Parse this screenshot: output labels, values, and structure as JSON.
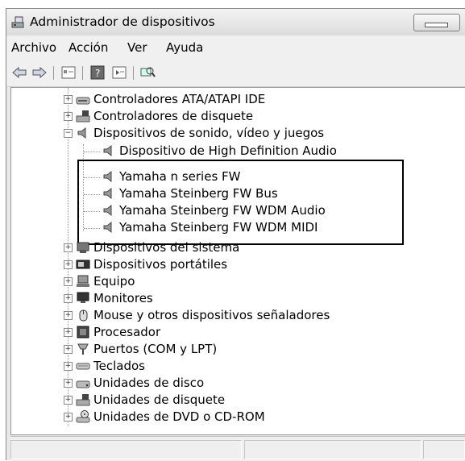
{
  "window": {
    "title": "Administrador de dispositivos"
  },
  "menu": {
    "items": [
      {
        "label": "Archivo"
      },
      {
        "label": "Acción"
      },
      {
        "label": "Ver"
      },
      {
        "label": "Ayuda"
      }
    ]
  },
  "toolbar": {
    "buttons": [
      "back-arrow-icon",
      "forward-arrow-icon",
      "properties-icon",
      "help-icon",
      "details-icon",
      "scan-hardware-icon"
    ]
  },
  "tree": {
    "items": [
      {
        "label": "Controladores ATA/ATAPI IDE",
        "icon": "ide-controller-icon",
        "level": 1,
        "expander": "+"
      },
      {
        "label": "Controladores de disquete",
        "icon": "floppy-controller-icon",
        "level": 1,
        "expander": "+"
      },
      {
        "label": "Dispositivos de sonido, vídeo y juegos",
        "icon": "speaker-icon",
        "level": 1,
        "expander": "-"
      },
      {
        "label": "Dispositivo de High Definition Audio",
        "icon": "speaker-icon",
        "level": 2
      },
      {
        "label": "Yamaha n series FW",
        "icon": "speaker-icon",
        "level": 2
      },
      {
        "label": "Yamaha Steinberg FW Bus",
        "icon": "speaker-icon",
        "level": 2
      },
      {
        "label": "Yamaha Steinberg FW WDM Audio",
        "icon": "speaker-icon",
        "level": 2
      },
      {
        "label": "Yamaha Steinberg FW WDM MIDI",
        "icon": "speaker-icon",
        "level": 2
      },
      {
        "label": "Dispositivos del sistema",
        "icon": "system-device-icon",
        "level": 1,
        "expander": "+"
      },
      {
        "label": "Dispositivos portátiles",
        "icon": "portable-device-icon",
        "level": 1,
        "expander": "+"
      },
      {
        "label": "Equipo",
        "icon": "computer-icon",
        "level": 1,
        "expander": "+"
      },
      {
        "label": "Monitores",
        "icon": "monitor-icon",
        "level": 1,
        "expander": "+"
      },
      {
        "label": "Mouse y otros dispositivos señaladores",
        "icon": "mouse-icon",
        "level": 1,
        "expander": "+"
      },
      {
        "label": "Procesador",
        "icon": "processor-icon",
        "level": 1,
        "expander": "+"
      },
      {
        "label": "Puertos (COM y LPT)",
        "icon": "port-icon",
        "level": 1,
        "expander": "+"
      },
      {
        "label": "Teclados",
        "icon": "keyboard-icon",
        "level": 1,
        "expander": "+"
      },
      {
        "label": "Unidades de disco",
        "icon": "disk-drive-icon",
        "level": 1,
        "expander": "+"
      },
      {
        "label": "Unidades de disquete",
        "icon": "floppy-drive-icon",
        "level": 1,
        "expander": "+"
      },
      {
        "label": "Unidades de DVD o CD-ROM",
        "icon": "dvd-drive-icon",
        "level": 1,
        "expander": "+"
      }
    ]
  }
}
